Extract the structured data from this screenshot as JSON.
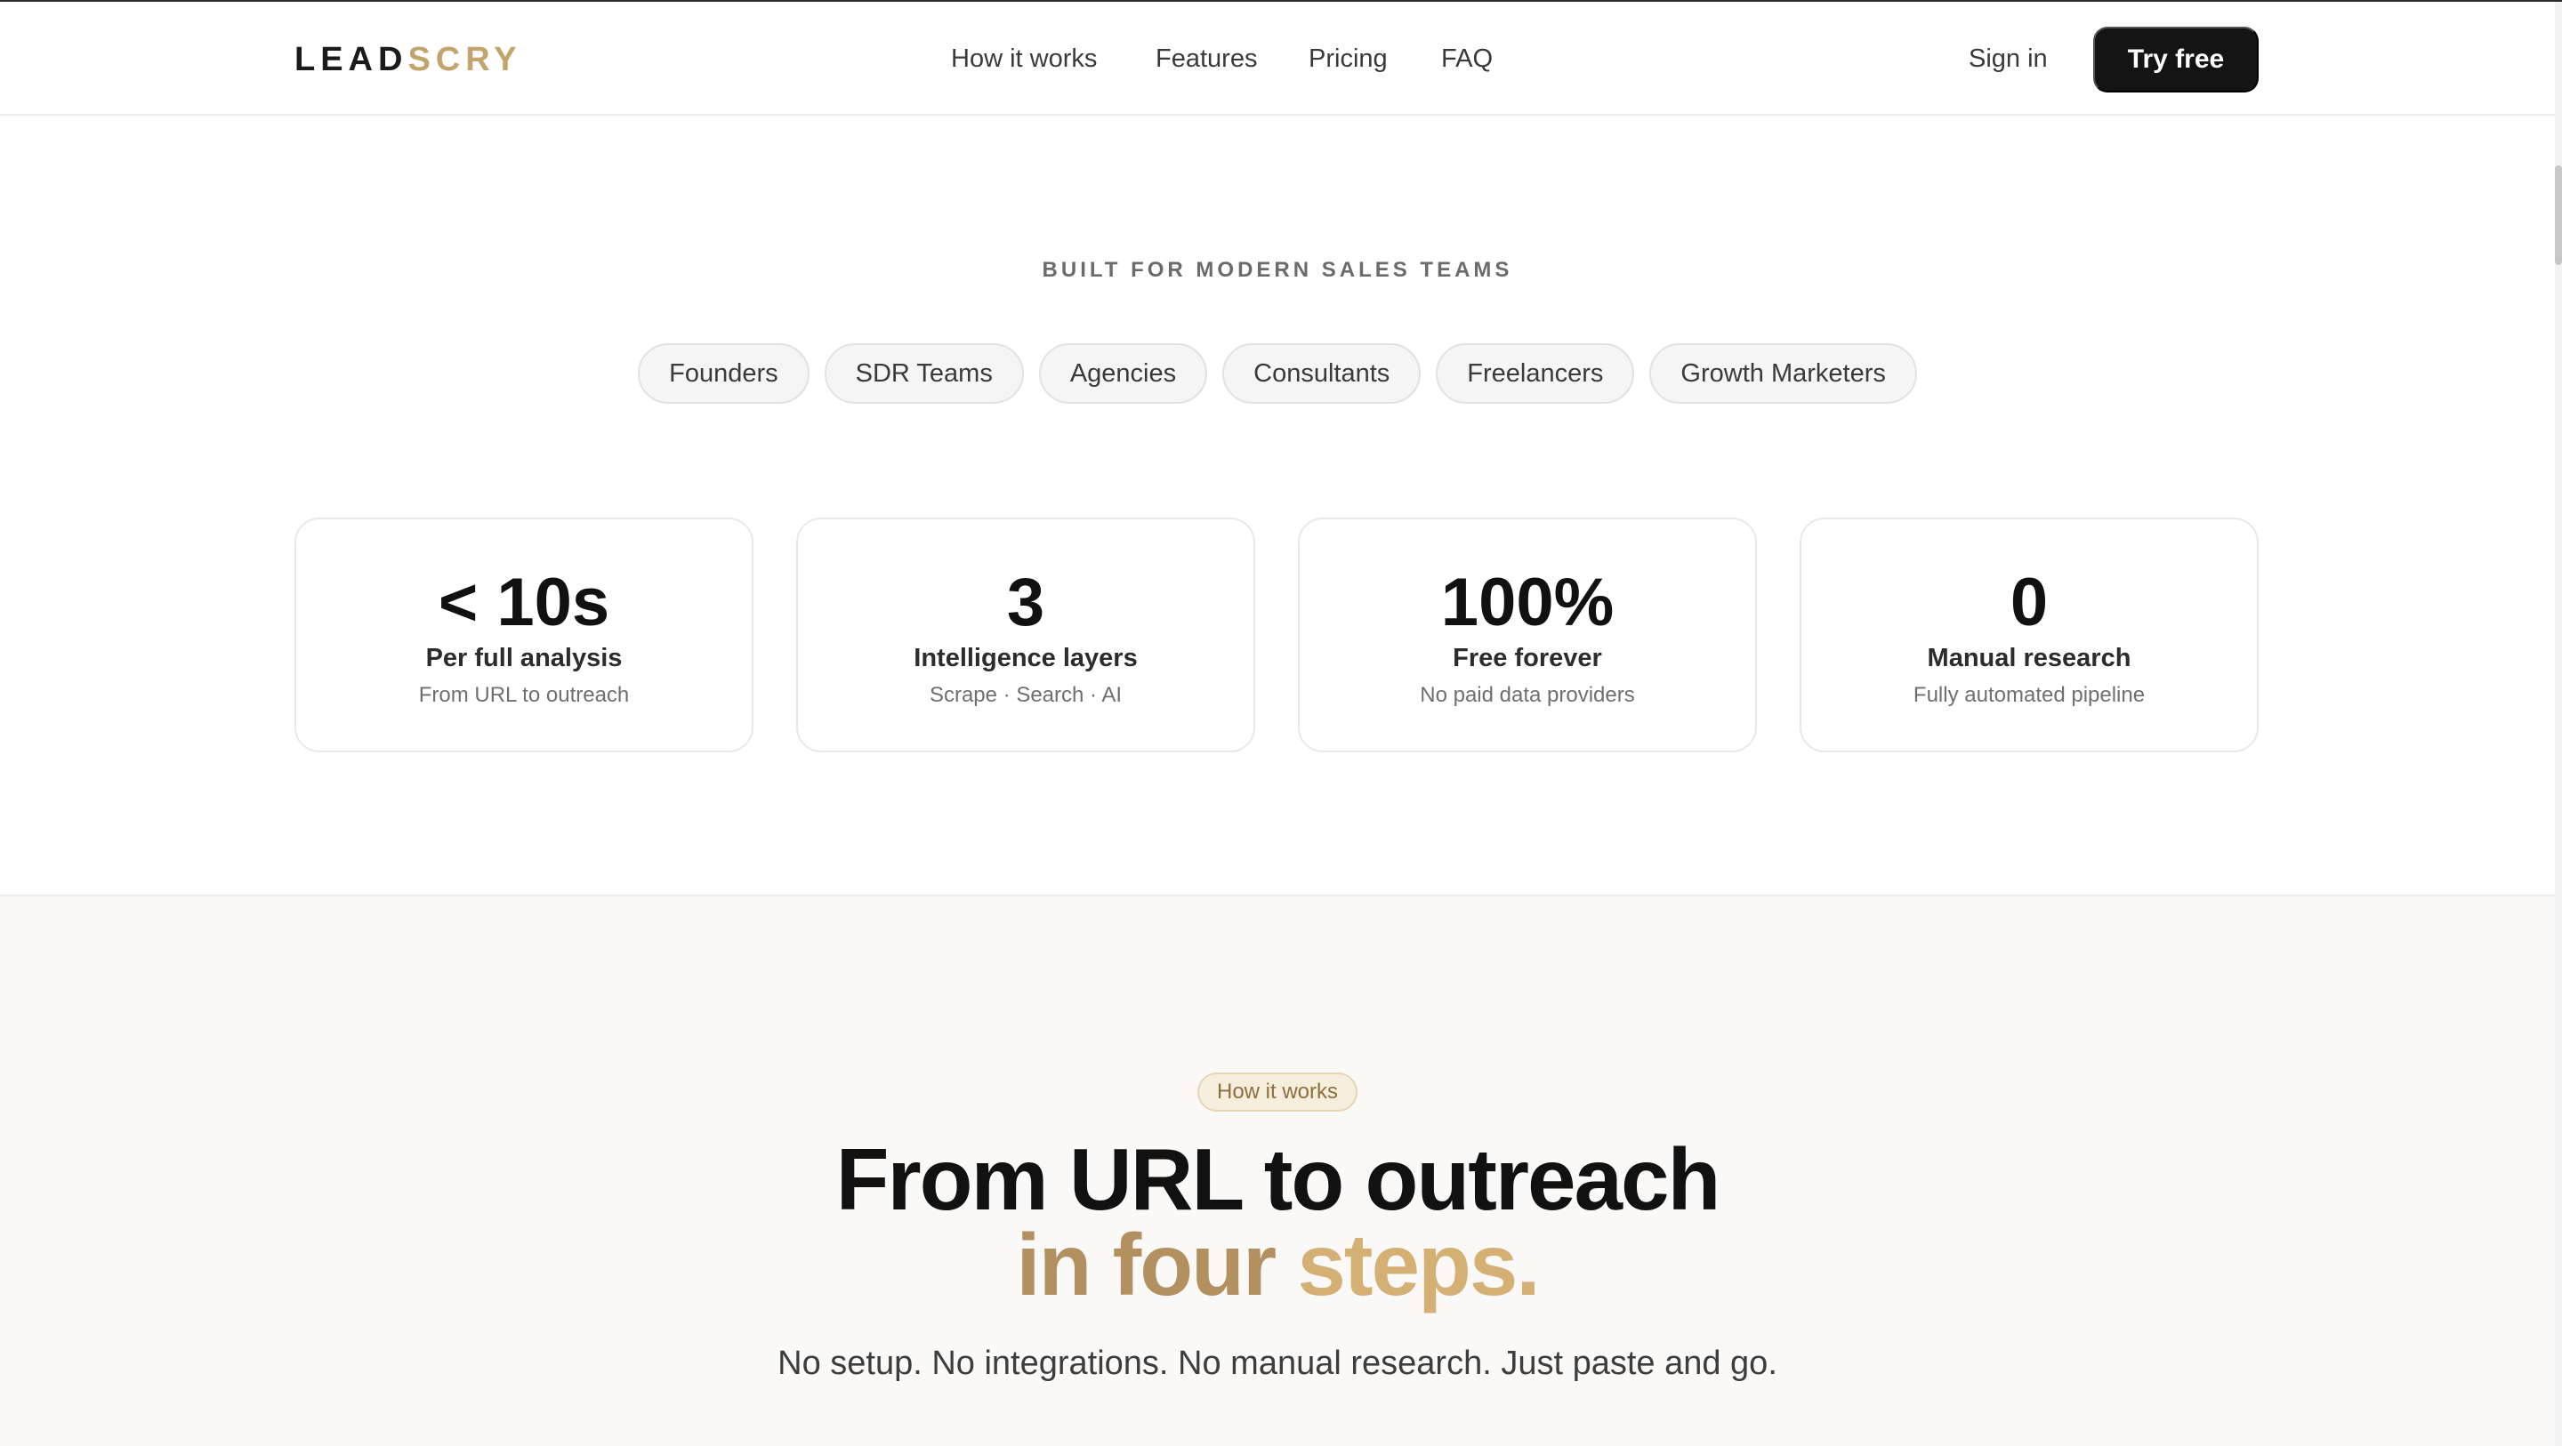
{
  "header": {
    "logo_part1": "LEAD",
    "logo_part2": "SCRY",
    "nav": [
      "How it works",
      "Features",
      "Pricing",
      "FAQ"
    ],
    "sign_in": "Sign in",
    "cta": "Try free"
  },
  "audience": {
    "eyebrow": "BUILT FOR MODERN SALES TEAMS",
    "pills": [
      "Founders",
      "SDR Teams",
      "Agencies",
      "Consultants",
      "Freelancers",
      "Growth Marketers"
    ]
  },
  "stats": [
    {
      "value": "< 10s",
      "label": "Per full analysis",
      "sub": "From URL to outreach"
    },
    {
      "value": "3",
      "label": "Intelligence layers",
      "sub": "Scrape · Search · AI"
    },
    {
      "value": "100%",
      "label": "Free forever",
      "sub": "No paid data providers"
    },
    {
      "value": "0",
      "label": "Manual research",
      "sub": "Fully automated pipeline"
    }
  ],
  "how": {
    "badge": "How it works",
    "title_line1": "From URL to outreach",
    "title_line2_a": "in four ",
    "title_line2_b": "steps.",
    "subtitle": "No setup. No integrations. No manual research. Just paste and go."
  },
  "colors": {
    "accent": "#c2a46c",
    "cta_bg": "#141414",
    "section_bg": "#faf9f7"
  }
}
